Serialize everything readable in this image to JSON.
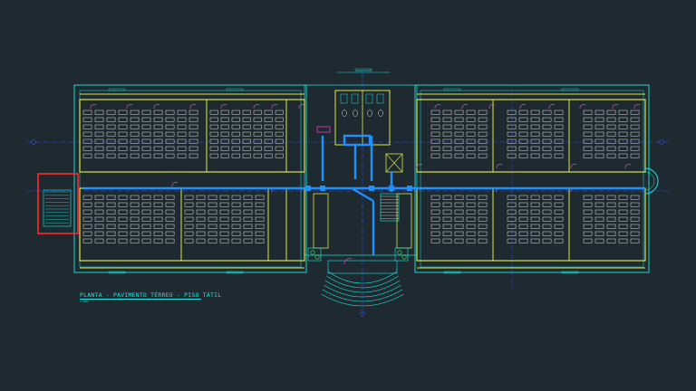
{
  "drawing": {
    "title": "PLANTA - PAVIMENTO TÉRREO - PISO TÁTIL",
    "scale_note": "1:100"
  },
  "colors": {
    "background": "#1f2a30",
    "wall": "#d8e64a",
    "outline": "#19e6e0",
    "axis": "#2d4dff",
    "tactile": "#1e90ff",
    "furniture": "#e0e0e0",
    "door": "#ff3cd2",
    "fire_stair": "#ff2a2a",
    "vegetation": "#3cff6a"
  },
  "rooms": {
    "left_classrooms": 4,
    "right_classrooms": 6
  }
}
